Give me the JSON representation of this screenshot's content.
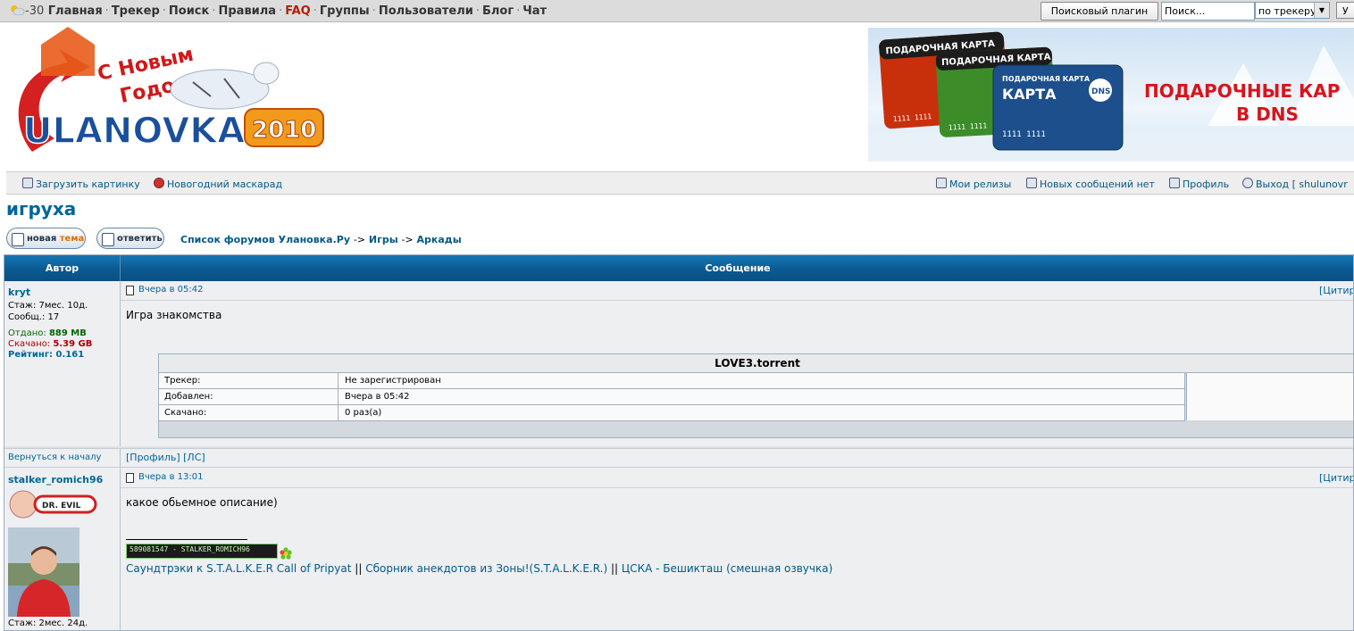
{
  "topbar": {
    "weather": "-30",
    "nav": [
      "Главная",
      "Трекер",
      "Поиск",
      "Правила",
      "FAQ",
      "Группы",
      "Пользователи",
      "Блог",
      "Чат"
    ],
    "search_plugin_label": "Поисковый плагин",
    "search_placeholder": "Поиск...",
    "search_scope": "по трекеру",
    "search_go": "У"
  },
  "logo": {
    "text": "ULANOVKA",
    "year": "2010",
    "greeting_line1": "С Новым",
    "greeting_line2": "Годом!"
  },
  "banner": {
    "card_label": "ПОДАРОЧНАЯ КАРТА",
    "card_label_main": "КАРТА",
    "card_number": "1111 1111",
    "brand": "DNS",
    "headline_line1": "ПОДАРОЧНЫЕ КАР",
    "headline_line2": "В DNS"
  },
  "userbar": {
    "upload": "Загрузить картинку",
    "masquerade": "Новогодний маскарад",
    "my_releases": "Мои релизы",
    "new_messages": "Новых сообщений нет",
    "profile": "Профиль",
    "logout": "Выход [ shulunovr"
  },
  "topic": {
    "title": "игруха",
    "new_topic_a": "новая",
    "new_topic_b": "тема",
    "reply": "ответить",
    "breadcrumb": [
      "Список форумов Улановка.Ру",
      "Игры",
      "Аркады"
    ],
    "breadcrumb_sep": "->"
  },
  "table_header": {
    "author": "Автор",
    "message": "Сообщение"
  },
  "posts": [
    {
      "author": "kryt",
      "stazh": "Стаж: 7мес. 10д.",
      "soobsh": "Сообщ.: 17",
      "otdano_label": "Отдано:",
      "otdano_value": "889 MB",
      "skachano_label": "Скачано:",
      "skachano_value": "5.39 GB",
      "rating_label": "Рейтинг:",
      "rating_value": "0.161",
      "date": "Вчера в 05:42",
      "quote": "[Цитир",
      "text": "Игра знакомства",
      "torrent": {
        "name": "LOVE3.torrent",
        "rows": [
          {
            "k": "Трекер:",
            "v": "Не зарегистрирован"
          },
          {
            "k": "Добавлен:",
            "v": "Вчера в 05:42"
          },
          {
            "k": "Скачано:",
            "v": "0 раз(а)"
          }
        ]
      },
      "back": "Вернуться к началу",
      "links": "[Профиль]  [ЛС]"
    },
    {
      "author": "stalker_romich96",
      "badge": "DR. EVIL",
      "stazh": "Стаж: 2мес. 24д.",
      "date": "Вчера в 13:01",
      "quote": "[Цитир",
      "text": "какое обьемное описание)",
      "userbar_text": "589081547 - STALKER_ROMICH96",
      "sig_links": [
        "Саундтрэки к S.T.A.L.K.E.R Call of Pripyat",
        "Сборник анекдотов из Зоны!(S.T.A.L.K.E.R.)",
        "ЦСКА - Бешикташ (смешная озвучка)"
      ],
      "sig_sep": "||"
    }
  ],
  "colors": {
    "header_blue": "#0b5a92",
    "link": "#006699",
    "faq": "#b22000",
    "green": "#006600",
    "dark_red": "#8b0000"
  }
}
